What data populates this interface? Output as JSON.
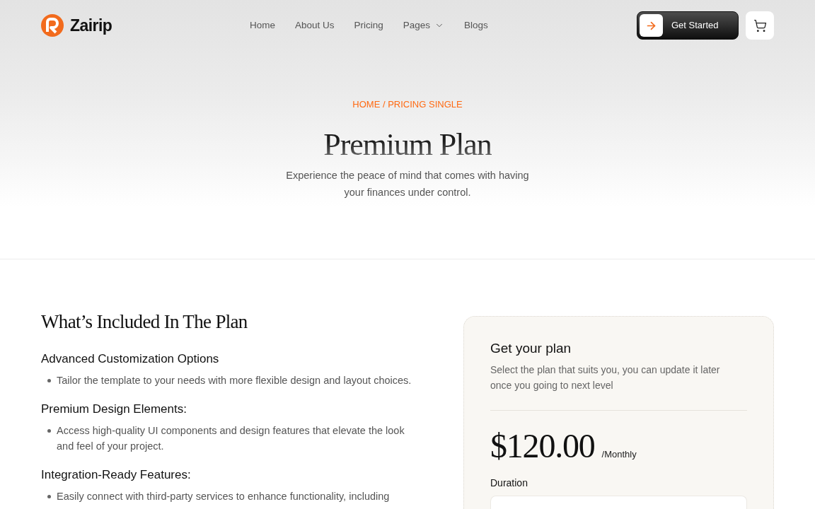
{
  "header": {
    "logo": {
      "name": "Zairip"
    },
    "nav": [
      {
        "label": "Home",
        "dropdown": false
      },
      {
        "label": "About Us",
        "dropdown": false
      },
      {
        "label": "Pricing",
        "dropdown": false
      },
      {
        "label": "Pages",
        "dropdown": true
      },
      {
        "label": "Blogs",
        "dropdown": false
      }
    ],
    "cta": {
      "label": "Get Started"
    }
  },
  "hero": {
    "breadcrumb": "HOME / PRICING SINGLE",
    "title": "Premium Plan",
    "subtitle": "Experience the peace of mind that comes with having your finances under control."
  },
  "features": {
    "title": "What’s Included In The Plan",
    "groups": [
      {
        "heading": "Advanced Customization Options",
        "bullets": [
          "Tailor the template to your needs with more flexible design and layout choices."
        ]
      },
      {
        "heading": "Premium Design Elements:",
        "bullets": [
          "Access high-quality UI components and design features that elevate the look and feel of your project."
        ]
      },
      {
        "heading": "Integration-Ready Features:",
        "bullets": [
          "Easily connect with third-party services to enhance functionality, including"
        ]
      }
    ]
  },
  "plan_card": {
    "title": "Get your plan",
    "description": "Select the plan that suits you, you can update it later once you going to next level",
    "price": "$120.00",
    "period": "/Monthly",
    "duration": {
      "label": "Duration"
    }
  }
}
